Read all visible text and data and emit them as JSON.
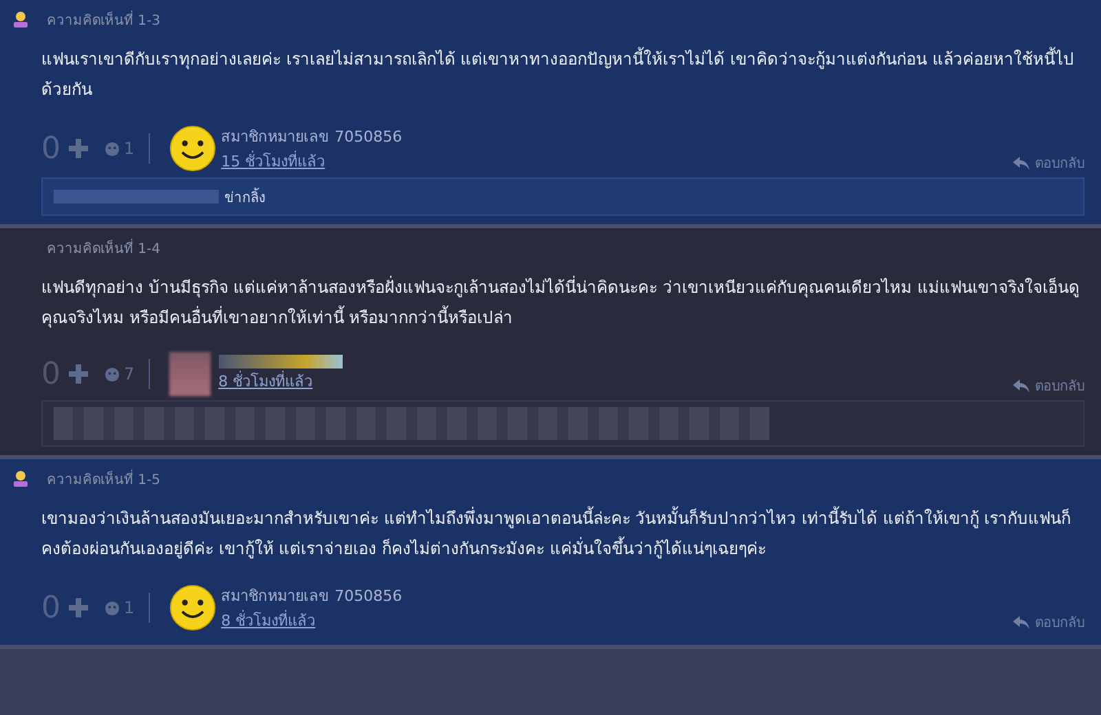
{
  "comments": [
    {
      "kind": "member",
      "number": "ความคิดเห็นที่ 1-3",
      "body": "แฟนเราเขาดีกับเราทุกอย่างเลยค่ะ เราเลยไม่สามารถเลิกได้ แต่เขาหาทางออกปัญหานี้ให้เราไม่ได้ เขาคิดว่าจะกู้มาแต่งกันก่อน แล้วค่อยหาใช้หนี้ไปด้วยกัน",
      "score": "0",
      "emotion_count": "1",
      "avatar": {
        "kind": "smiley"
      },
      "author": "สมาชิกหมายเลข 7050856",
      "time": "15 ชั่วโมงที่แล้ว",
      "reply_label": "ตอบกลับ",
      "replies": [
        {
          "kind": "partly-blurred",
          "text": "ข่ากลิ้ง"
        }
      ]
    },
    {
      "kind": "owner",
      "number": "ความคิดเห็นที่ 1-4",
      "body": "แฟนดีทุกอย่าง บ้านมีธุรกิจ แต่แค่หาล้านสองหรือฝั่งแฟนจะกูเล้านสองไม่ได้นี่น่าคิดนะคะ ว่าเขาเหนียวแค่กับคุณคนเดียวไหม แม่แฟนเขาจริงใจเอ็นดูคุณจริงไหม หรือมีคนอื่นที่เขาอยากให้เท่านี้ หรือมากกว่านี้หรือเปล่า",
      "score": "0",
      "emotion_count": "7",
      "avatar": {
        "kind": "blurred"
      },
      "time": "8 ชั่วโมงที่แล้ว",
      "reply_label": "ตอบกลับ",
      "replies": [
        {
          "kind": "blurred"
        }
      ]
    },
    {
      "kind": "member",
      "number": "ความคิดเห็นที่ 1-5",
      "body": "เขามองว่าเงินล้านสองมันเยอะมากสำหรับเขาค่ะ แต่ทำไมถึงพึ่งมาพูดเอาตอนนี้ล่ะคะ วันหมั้นก็รับปากว่าไหว เท่านี้รับได้ แต่ถ้าให้เขากู้ เรากับแฟนก็คงต้องผ่อนกันเองอยู่ดีค่ะ เขากู้ให้ แต่เราจ่ายเอง ก็คงไม่ต่างกันกระมังคะ แค่มั่นใจขึ้นว่ากู้ได้แน่ๆเฉยๆค่ะ",
      "score": "0",
      "emotion_count": "1",
      "avatar": {
        "kind": "smiley"
      },
      "author": "สมาชิกหมายเลข 7050856",
      "time": "8 ชั่วโมงที่แล้ว",
      "reply_label": "ตอบกลับ"
    }
  ]
}
